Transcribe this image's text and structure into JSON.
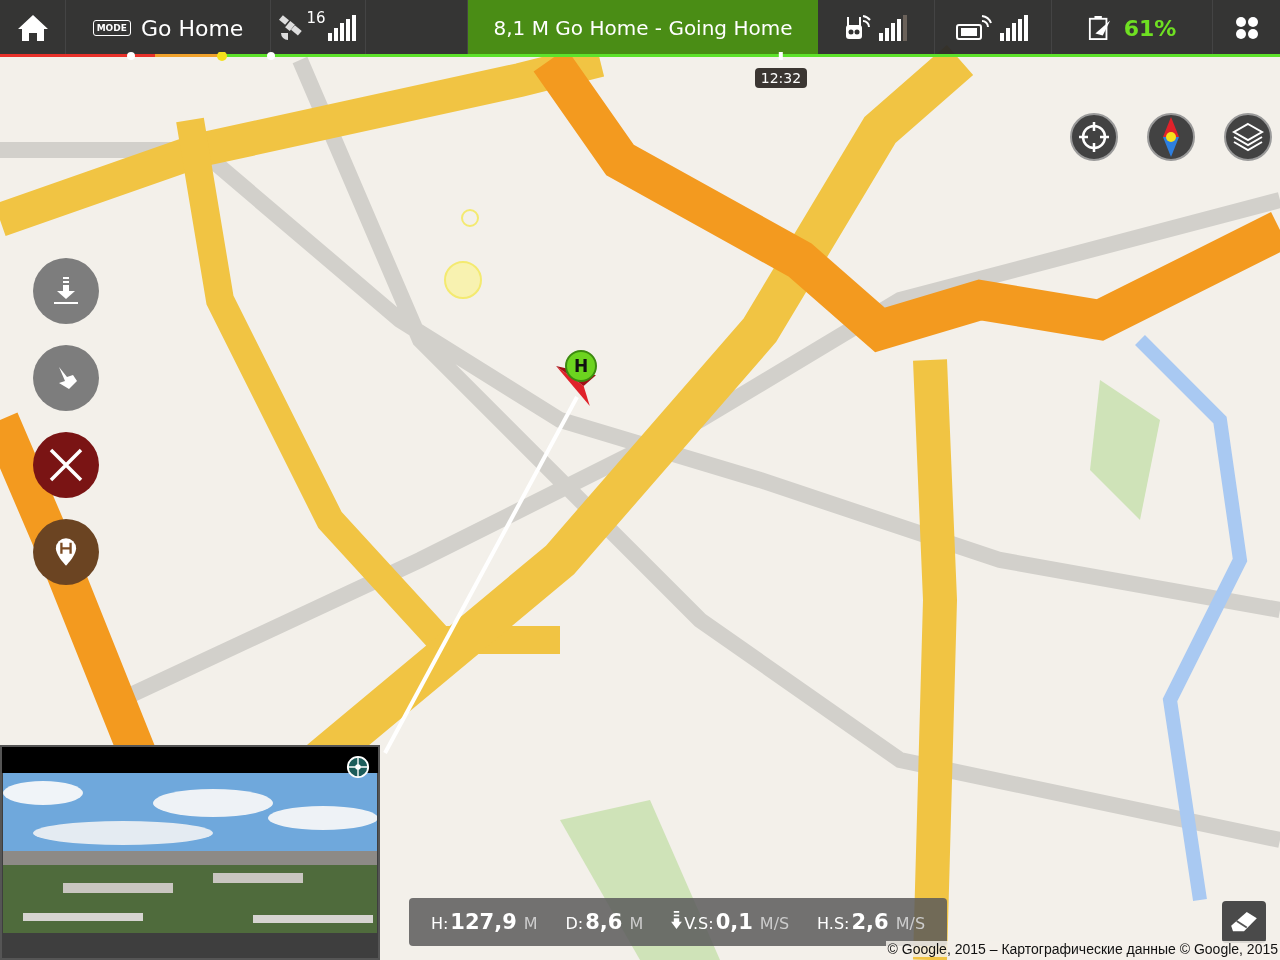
{
  "top_bar": {
    "mode_badge": "MODE",
    "mode": "Go Home",
    "satellites": "16",
    "status": "8,1 M Go Home - Going Home",
    "battery": "61%",
    "progress_time": "12:32"
  },
  "flight_progress": {
    "level": 0.61
  },
  "home_marker": "H",
  "telemetry": [
    {
      "kind": "plain",
      "label": "H:",
      "value": "127,9",
      "unit": "M"
    },
    {
      "kind": "plain",
      "label": "D:",
      "value": "8,6",
      "unit": "M"
    },
    {
      "kind": "descent",
      "label": "V.S:",
      "value": "0,1",
      "unit": "M/S"
    },
    {
      "kind": "plain",
      "label": "H.S:",
      "value": "2,6",
      "unit": "M/S"
    }
  ],
  "attribution": "© Google, 2015 – Картографические данные © Google, 2015"
}
